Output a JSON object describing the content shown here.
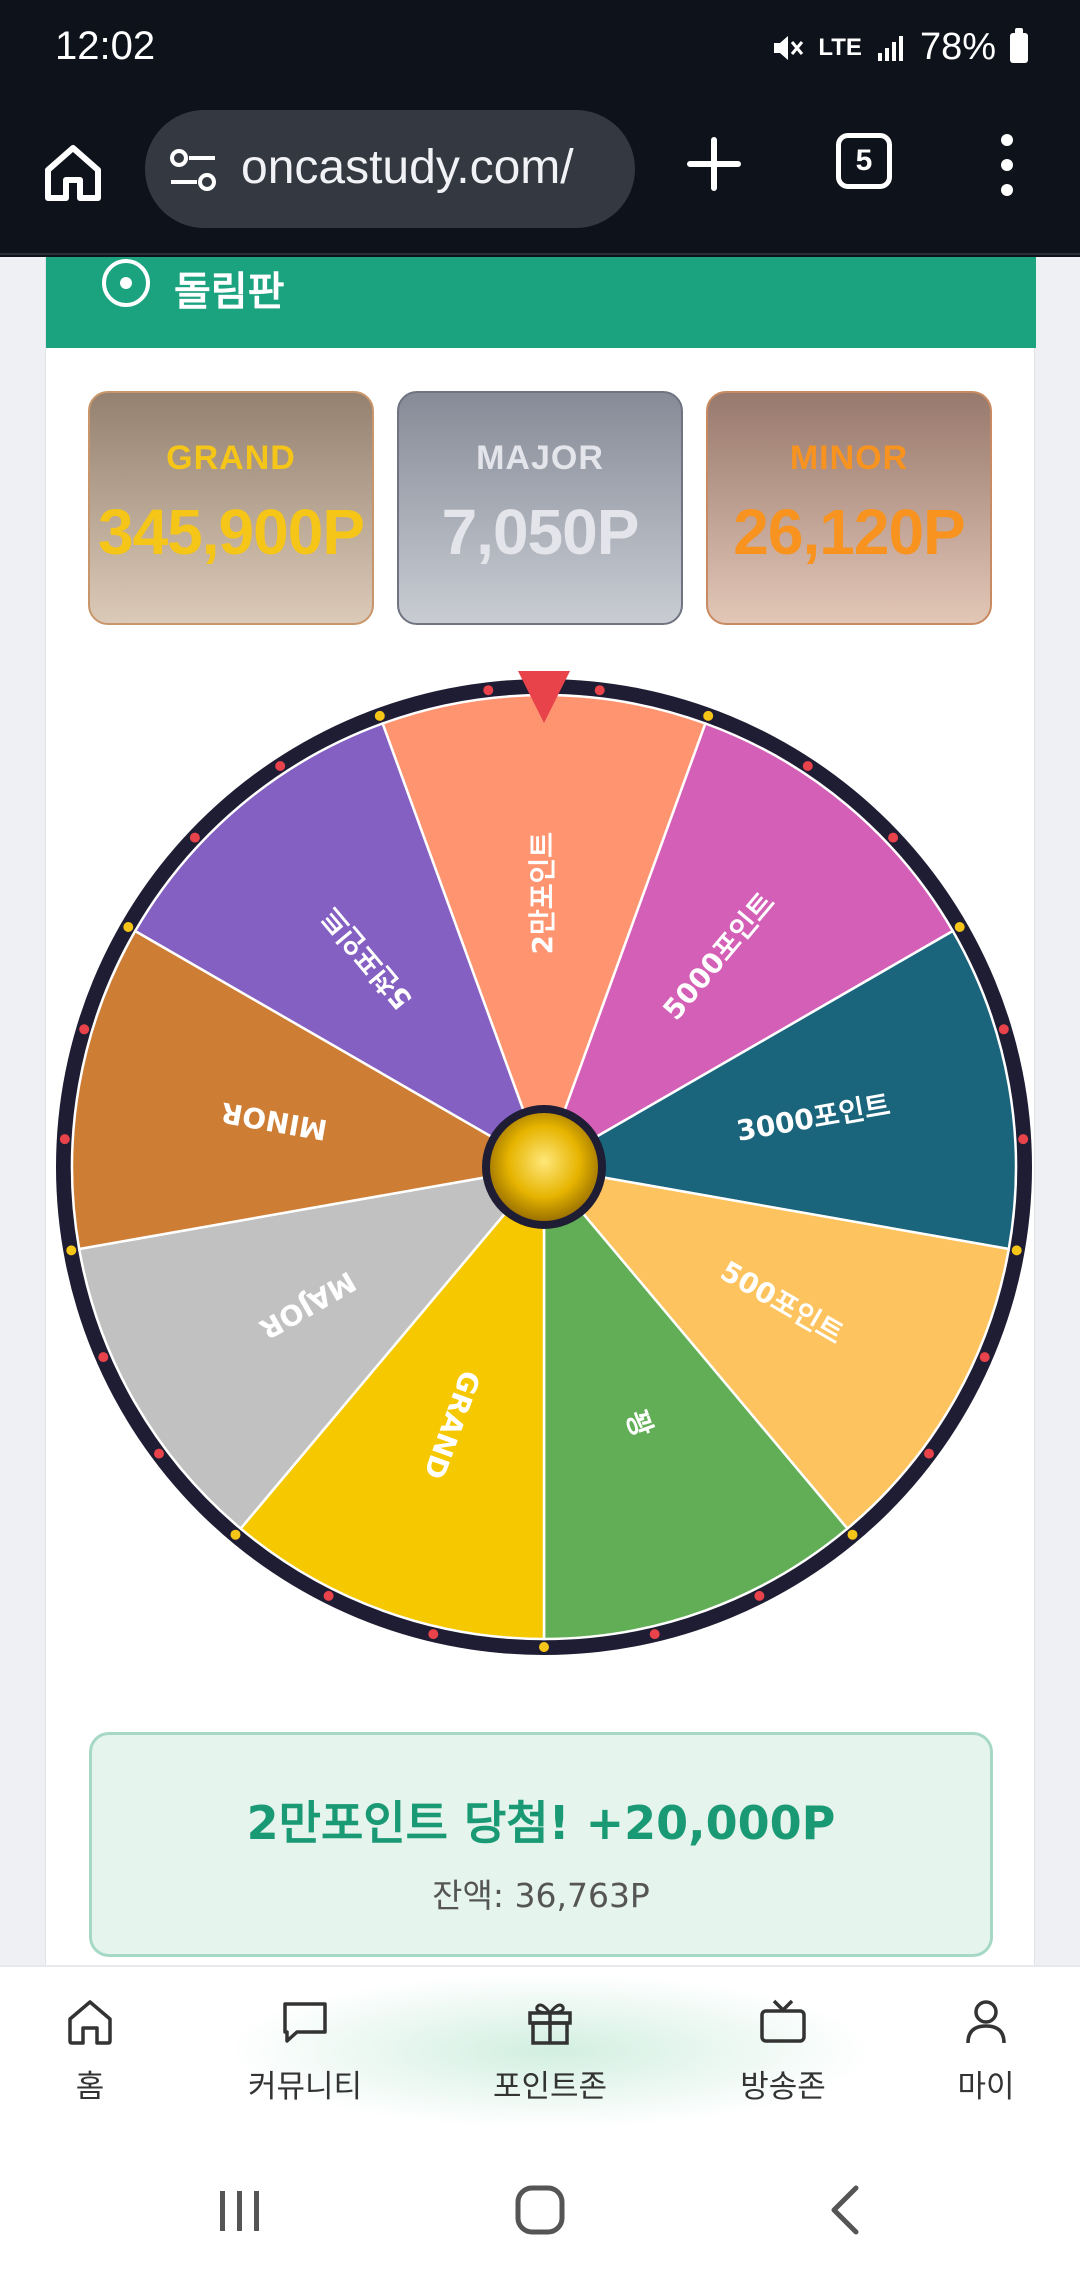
{
  "status_bar": {
    "time": "12:02",
    "network": "LTE",
    "battery": "78%"
  },
  "browser": {
    "url": "oncastudy.com/",
    "tab_count": "5"
  },
  "card": {
    "title": "돌림판"
  },
  "jackpots": [
    {
      "label": "GRAND",
      "value": "345,900P",
      "color": "#f5c518"
    },
    {
      "label": "MAJOR",
      "value": "7,050P",
      "color": "#e3e5ea"
    },
    {
      "label": "MINOR",
      "value": "26,120P",
      "color": "#f7931e"
    }
  ],
  "wheel": {
    "segments": [
      {
        "label": "2만포인트",
        "color": "#ff9470"
      },
      {
        "label": "5000포인트",
        "color": "#d45fb6"
      },
      {
        "label": "3000포인트",
        "color": "#1b657c"
      },
      {
        "label": "500포인트",
        "color": "#fdc35f"
      },
      {
        "label": "꽝",
        "color": "#62ae56"
      },
      {
        "label": "GRAND",
        "color": "#f5c800"
      },
      {
        "label": "MAJOR",
        "color": "#c1c1c1"
      },
      {
        "label": "MINOR",
        "color": "#cd7d34"
      },
      {
        "label": "5천포인트",
        "color": "#8460c2"
      }
    ],
    "pointer_color": "#e8424a",
    "rim_color": "#1f1d33",
    "hub_color": "#d9a300"
  },
  "result": {
    "title": "2만포인트 당첨! +20,000P",
    "balance": "잔액: 36,763P"
  },
  "bottom_nav": [
    {
      "label": "홈",
      "icon": "home-icon"
    },
    {
      "label": "커뮤니티",
      "icon": "chat-icon"
    },
    {
      "label": "포인트존",
      "icon": "gift-icon"
    },
    {
      "label": "방송존",
      "icon": "tv-icon"
    },
    {
      "label": "마이",
      "icon": "user-icon"
    }
  ],
  "accent_color": "#1ba27f"
}
